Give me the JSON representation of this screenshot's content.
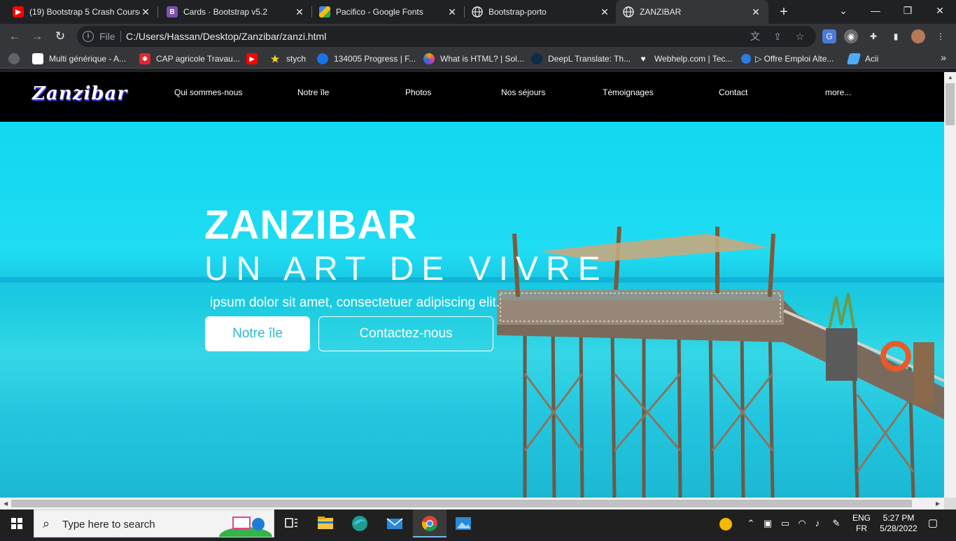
{
  "browser": {
    "tabs": [
      {
        "title": "(19) Bootstrap 5 Crash Course",
        "favicon": "youtube-icon",
        "color": "#ff0000",
        "active": false
      },
      {
        "title": "Cards · Bootstrap v5.2",
        "favicon": "bootstrap-icon",
        "color": "#7952b3",
        "active": false
      },
      {
        "title": "Pacifico - Google Fonts",
        "favicon": "google-fonts-icon",
        "color": "#4285f4",
        "active": false
      },
      {
        "title": "Bootstrap-porto",
        "favicon": "globe-icon",
        "color": "#9aa0a6",
        "active": false
      },
      {
        "title": "ZANZIBAR",
        "favicon": "globe-icon",
        "color": "#9aa0a6",
        "active": true
      }
    ],
    "new_tab": "+",
    "window_controls": {
      "minimize": "—",
      "maximize": "❐",
      "close": "✕",
      "tab_search": "⌄"
    },
    "toolbar": {
      "back": "←",
      "forward": "→",
      "reload": "↻",
      "scheme_label": "File",
      "url": "C:/Users/Hassan/Desktop/Zanzibar/zanzi.html"
    },
    "bookmarks": [
      {
        "label": "Multi générique - A...",
        "icon": "page-icon",
        "color": "#ffffff"
      },
      {
        "label": "CAP agricole Travau...",
        "icon": "asterisk-icon",
        "color": "#e3262e"
      },
      {
        "label": "",
        "icon": "youtube-icon",
        "color": "#ff0000"
      },
      {
        "label": "stych",
        "icon": "star-icon",
        "color": "#f5d90a"
      },
      {
        "label": "134005 Progress | F...",
        "icon": "progress-icon",
        "color": "#1a73e8"
      },
      {
        "label": "What is HTML? | Sol...",
        "icon": "sololearn-icon",
        "color": "#8b5cf6"
      },
      {
        "label": "DeepL Translate: Th...",
        "icon": "deepl-icon",
        "color": "#0f2b46"
      },
      {
        "label": "Webhelp.com | Tec...",
        "icon": "webhelp-icon",
        "color": "#ffffff"
      },
      {
        "label": "▷ Offre Emploi Alte...",
        "icon": "offre-icon",
        "color": "#2a7de1"
      },
      {
        "label": "Acii",
        "icon": "acii-icon",
        "color": "#4dabf7"
      }
    ],
    "bookmarks_more": "»"
  },
  "site": {
    "logo": "Zanzibar",
    "nav": [
      "Qui sommes-nous",
      "Notre île",
      "Photos",
      "Nos séjours",
      "Témoignages",
      "Contact",
      "more..."
    ],
    "hero": {
      "title": "ZANZIBAR",
      "subtitle": "UN ART DE VIVRE",
      "text": "ipsum dolor sit amet, consectetuer adipiscing elit.",
      "btn_primary": "Notre île",
      "btn_secondary": "Contactez-nous"
    },
    "colors": {
      "nav_bg": "#000000",
      "sea": "#11d8f1",
      "button_text": "#2fb7d3"
    }
  },
  "taskbar": {
    "search_placeholder": "Type here to search",
    "language": "ENG",
    "layout": "FR",
    "time": "5:27 PM",
    "date": "5/28/2022"
  }
}
